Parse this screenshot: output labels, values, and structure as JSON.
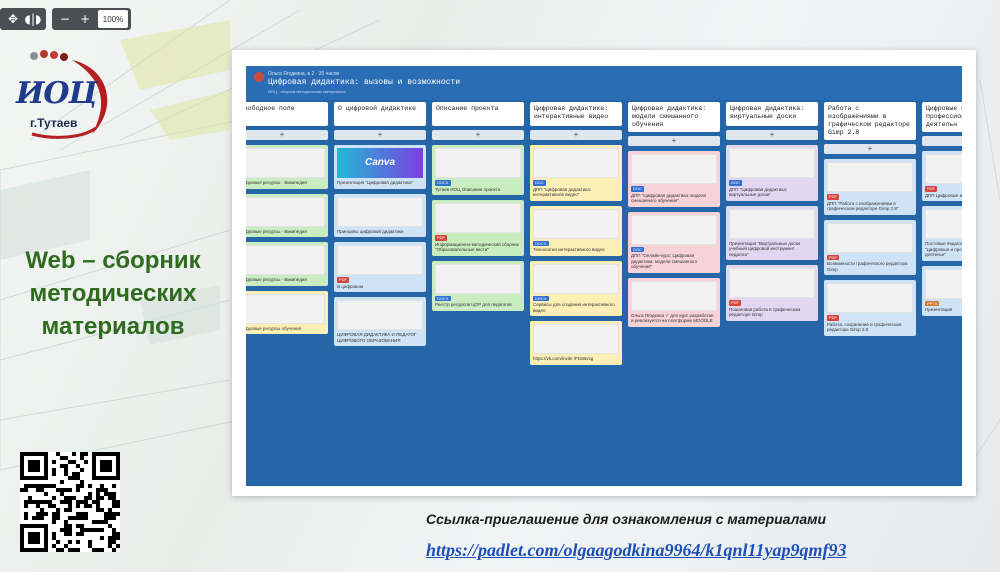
{
  "viewer": {
    "zoom": "100%",
    "icons": [
      "move-icon",
      "audio-icon",
      "zoom-out-icon",
      "zoom-in-icon"
    ]
  },
  "logo": {
    "text": "ИОЦ",
    "city": "г.Тутаев"
  },
  "heading": {
    "line1": "Web – сборник",
    "line2": "методических",
    "line3": "материалов"
  },
  "board": {
    "author": "Ольга Ягодкина, в 2 · 20 часов",
    "title": "Цифровая дидактика: вызовы и возможности",
    "subtitle": "ИОЦ · сборник методических материалов",
    "columns": [
      {
        "title": "Свободное поле",
        "cards": [
          {
            "tag": "",
            "color": "green",
            "text": "Цифровые ресурсы · Википедия"
          },
          {
            "tag": "",
            "color": "green",
            "text": "Цифровые ресурсы · Википедия"
          },
          {
            "tag": "",
            "color": "green",
            "text": "Цифровые ресурсы · Википедия"
          },
          {
            "tag": "",
            "color": "yellow",
            "text": "Цифровые ресурсы обучения"
          }
        ]
      },
      {
        "title": "О цифровой дидактике",
        "cards": [
          {
            "tag": "",
            "color": "blue",
            "text": "Презентация \"Цифровая дидактика\"",
            "canva": "Canva"
          },
          {
            "tag": "",
            "color": "blue",
            "text": "Принципы цифровой дидактики"
          },
          {
            "tag": "PDF",
            "color": "blue",
            "text": "В цифровом"
          },
          {
            "tag": "",
            "color": "blue",
            "text": "ЦИФРОВАЯ ДИДАКТИКА И ПЕДАГОГ ЦИФРОВОГО ОБРАЗОВАНИЯ"
          }
        ]
      },
      {
        "title": "Описание проекта",
        "cards": [
          {
            "tag": "DOCX",
            "color": "green",
            "text": "Тутаев ИОЦ Описание проекта"
          },
          {
            "tag": "PDF",
            "color": "green",
            "text": "Информационно-методический сборник \"Образовательные вести\""
          },
          {
            "tag": "DOCX",
            "color": "green",
            "text": "Реестр ресурсов ЦОР для педагогов"
          }
        ]
      },
      {
        "title": "Цифровая дидактика: интерактивные видео",
        "cards": [
          {
            "tag": "DOC",
            "color": "yellow",
            "text": "ДПП \"Цифровая дидактика: интерактивное видео\""
          },
          {
            "tag": "DOCX",
            "color": "yellow",
            "text": "Технологии интерактивного видео"
          },
          {
            "tag": "DOCX",
            "color": "yellow",
            "text": "Сервисы для создания интерактивного видео"
          },
          {
            "tag": "",
            "color": "yellow",
            "text": "https://vk.com/invite /FDxBvsg"
          }
        ]
      },
      {
        "title": "Цифровая дидактика: модели смешанного обучения",
        "cards": [
          {
            "tag": "DOC",
            "color": "pink",
            "text": "ДПП \"Цифровая дидактика: модели смешанного обучения\""
          },
          {
            "tag": "DOC",
            "color": "pink",
            "text": "ДПП \"Онлайн-курс: Цифровая дидактика: модели смешанного обучения\""
          },
          {
            "tag": "",
            "color": "pink",
            "text": "Ольга Ягодкина ✓ для курс разработан и реализуется на платформе MOODLE"
          }
        ]
      },
      {
        "title": "Цифровая дидактика: виртуальные доски",
        "cards": [
          {
            "tag": "DOC",
            "color": "lav",
            "text": "ДПП \"Цифровая дидактика: виртуальные доски\""
          },
          {
            "tag": "",
            "color": "lav",
            "text": "Презентация \"Виртуальные доски учебный цифровой инструмент педагога\""
          },
          {
            "tag": "PDF",
            "color": "lav",
            "text": "Пошаговая работа в графическом редакторе Gimp"
          }
        ]
      },
      {
        "title": "Работа с изображениями в графическом редакторе Gimp 2.8",
        "cards": [
          {
            "tag": "PDF",
            "color": "blue",
            "text": "ДПП \"Работа с изображениями в графическом редакторе Gimp 2.8\""
          },
          {
            "tag": "PDF",
            "color": "blue",
            "text": "Возможности графического редактора Gimp"
          },
          {
            "tag": "PDF",
            "color": "blue",
            "text": "Работа, сохранение и графическом редакторе Gimp 2.8"
          }
        ]
      },
      {
        "title": "Цифровые инструменты профессиональной деятельн",
        "cards": [
          {
            "tag": "PDF",
            "color": "blue",
            "text": "ДПП Цифровые инструменты"
          },
          {
            "tag": "",
            "color": "blue",
            "text": "Постовые педагог работн Тутаев \"Цифровые и профессиональной деятельн\""
          },
          {
            "tag": "PPTX",
            "color": "blue",
            "text": "Презентация"
          }
        ]
      }
    ]
  },
  "invite": {
    "text": "Ссылка-приглашение для ознакомления с материалами",
    "link": "https://padlet.com/olgaagodkina9964/k1qnl11yap9qmf93"
  },
  "colors": {
    "heading": "#2f6b1e",
    "link": "#1c4fb8",
    "board": "#2566a8"
  }
}
